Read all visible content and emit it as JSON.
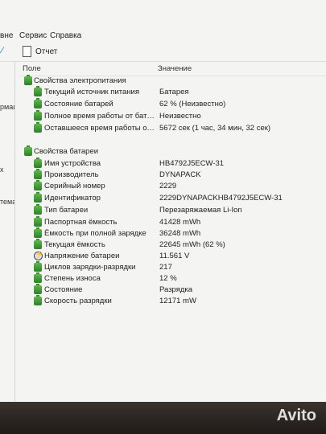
{
  "menu": {
    "items": [
      "вне",
      "Сервис",
      "Справка"
    ]
  },
  "toolbar": {
    "report_label": "Отчет"
  },
  "sidebar": {
    "items": [
      "рмац",
      "х",
      "тема"
    ]
  },
  "columns": {
    "field": "Поле",
    "value": "Значение"
  },
  "power_props": {
    "title": "Свойства электропитания",
    "rows": [
      {
        "field": "Текущий источник питания",
        "value": "Батарея"
      },
      {
        "field": "Состояние батарей",
        "value": "62 % (Неизвестно)"
      },
      {
        "field": "Полное время работы от бата...",
        "value": "Неизвестно"
      },
      {
        "field": "Оставшееся время работы от ...",
        "value": "5672 сек (1 час, 34 мин, 32 сек)"
      }
    ]
  },
  "battery_props": {
    "title": "Свойства батареи",
    "rows": [
      {
        "field": "Имя устройства",
        "value": "HB4792J5ECW-31"
      },
      {
        "field": "Производитель",
        "value": "DYNAPACK"
      },
      {
        "field": "Серийный номер",
        "value": "2229"
      },
      {
        "field": "Идентификатор",
        "value": "2229DYNAPACKHB4792J5ECW-31"
      },
      {
        "field": "Тип батареи",
        "value": "Перезаряжаемая Li-Ion"
      },
      {
        "field": "Паспортная ёмкость",
        "value": "41428 mWh"
      },
      {
        "field": "Ёмкость при полной зарядке",
        "value": "36248 mWh"
      },
      {
        "field": "Текущая ёмкость",
        "value": "22645 mWh  (62 %)"
      },
      {
        "field": "Напряжение батареи",
        "value": "11.561 V"
      },
      {
        "field": "Циклов зарядки-разрядки",
        "value": "217"
      },
      {
        "field": "Степень износа",
        "value": "12 %"
      },
      {
        "field": "Состояние",
        "value": "Разрядка"
      },
      {
        "field": "Скорость разрядки",
        "value": "12171 mW"
      }
    ]
  },
  "watermark": "Avito"
}
